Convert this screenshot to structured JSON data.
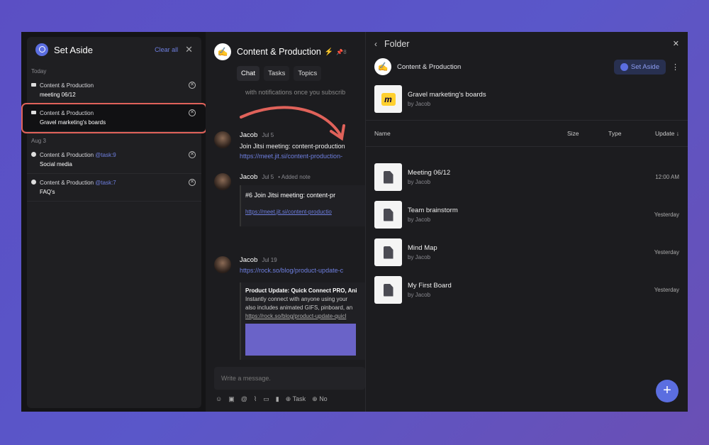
{
  "set_aside": {
    "title": "Set Aside",
    "clear_all": "Clear all",
    "groups": [
      {
        "label": "Today",
        "items": [
          {
            "channel": "Content & Production",
            "tag": "",
            "title": "meeting 06/12"
          },
          {
            "channel": "Content & Production",
            "tag": "",
            "title": "Gravel marketing's boards"
          }
        ]
      },
      {
        "label": "Aug 3",
        "items": [
          {
            "channel": "Content & Production",
            "tag": "@task:9",
            "title": "Social media"
          },
          {
            "channel": "Content & Production",
            "tag": "@task:7",
            "title": "FAQ's"
          }
        ]
      }
    ]
  },
  "chat": {
    "title": "Content & Production",
    "pins": "8",
    "tabs": [
      "Chat",
      "Tasks",
      "Topics"
    ],
    "snippet": "with notifications once you subscrib",
    "messages": [
      {
        "author": "Jacob",
        "date": "Jul 5",
        "text": "Join Jitsi meeting: content-production",
        "link": "https://meet.jit.si/content-production-"
      },
      {
        "author": "Jacob",
        "date": "Jul 5",
        "note": "Added note",
        "card_title": "#6 Join Jitsi meeting: content-pr",
        "link": "https://meet.jit.si/content-productio"
      },
      {
        "author": "Jacob",
        "date": "Jul 19",
        "link": "https://rock.so/blog/product-update-c",
        "card_title": "Product Update: Quick Connect PRO, Ani",
        "card_text": [
          "Instantly connect with anyone using your",
          "also includes animated GIFS, pinboard, an"
        ],
        "card_link": "https://rock.so/blog/product-update-quicl"
      }
    ],
    "composer_placeholder": "Write a message.",
    "tools": [
      "Task",
      "No"
    ]
  },
  "folder": {
    "title": "Folder",
    "channel": "Content & Production",
    "set_aside_btn": "Set Aside",
    "board": {
      "name": "Gravel marketing's boards",
      "by": "by Jacob"
    },
    "columns": [
      "Name",
      "Size",
      "Type",
      "Update"
    ],
    "files": [
      {
        "name": "Meeting 06/12",
        "by": "by Jacob",
        "update": "12:00 AM"
      },
      {
        "name": "Team brainstorm",
        "by": "by Jacob",
        "update": "Yesterday"
      },
      {
        "name": "Mind Map",
        "by": "by Jacob",
        "update": "Yesterday"
      },
      {
        "name": "My First Board",
        "by": "by Jacob",
        "update": "Yesterday"
      }
    ]
  },
  "colors": {
    "accent": "#5b6ee0",
    "highlight": "#e0625a"
  }
}
